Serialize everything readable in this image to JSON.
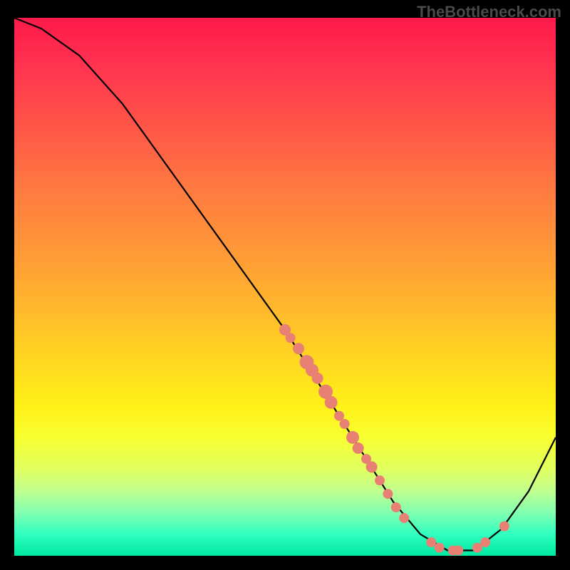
{
  "watermark": "TheBottleneck.com",
  "chart_data": {
    "type": "line",
    "title": "",
    "xlabel": "",
    "ylabel": "",
    "xlim": [
      0,
      100
    ],
    "ylim": [
      0,
      100
    ],
    "curve": [
      {
        "x": 0,
        "y": 100
      },
      {
        "x": 5,
        "y": 98
      },
      {
        "x": 12,
        "y": 93
      },
      {
        "x": 20,
        "y": 84
      },
      {
        "x": 30,
        "y": 70
      },
      {
        "x": 40,
        "y": 56
      },
      {
        "x": 50,
        "y": 42
      },
      {
        "x": 55,
        "y": 34
      },
      {
        "x": 60,
        "y": 26
      },
      {
        "x": 65,
        "y": 18
      },
      {
        "x": 70,
        "y": 10
      },
      {
        "x": 75,
        "y": 4
      },
      {
        "x": 80,
        "y": 1
      },
      {
        "x": 85,
        "y": 1
      },
      {
        "x": 90,
        "y": 5
      },
      {
        "x": 95,
        "y": 12
      },
      {
        "x": 100,
        "y": 22
      }
    ],
    "scatter_points": [
      {
        "x": 50,
        "y": 42,
        "r": 8
      },
      {
        "x": 51,
        "y": 40.5,
        "r": 7
      },
      {
        "x": 52.5,
        "y": 38.5,
        "r": 8
      },
      {
        "x": 54,
        "y": 36,
        "r": 10
      },
      {
        "x": 55,
        "y": 34.5,
        "r": 9
      },
      {
        "x": 56,
        "y": 33,
        "r": 8
      },
      {
        "x": 57.5,
        "y": 30.5,
        "r": 10
      },
      {
        "x": 58.5,
        "y": 28.5,
        "r": 9
      },
      {
        "x": 60,
        "y": 26,
        "r": 7
      },
      {
        "x": 61,
        "y": 24.5,
        "r": 7
      },
      {
        "x": 62.5,
        "y": 22,
        "r": 9
      },
      {
        "x": 63.5,
        "y": 20,
        "r": 8
      },
      {
        "x": 65,
        "y": 18,
        "r": 7
      },
      {
        "x": 66,
        "y": 16.5,
        "r": 8
      },
      {
        "x": 67.5,
        "y": 14,
        "r": 7
      },
      {
        "x": 69,
        "y": 11.5,
        "r": 7
      },
      {
        "x": 70.5,
        "y": 9,
        "r": 7
      },
      {
        "x": 72,
        "y": 7,
        "r": 7
      },
      {
        "x": 77,
        "y": 2.5,
        "r": 7
      },
      {
        "x": 78.5,
        "y": 1.5,
        "r": 7
      },
      {
        "x": 81,
        "y": 1,
        "r": 7
      },
      {
        "x": 82,
        "y": 1,
        "r": 7
      },
      {
        "x": 85.5,
        "y": 1.5,
        "r": 7
      },
      {
        "x": 87,
        "y": 2.5,
        "r": 7
      },
      {
        "x": 90.5,
        "y": 5.5,
        "r": 7
      }
    ]
  }
}
